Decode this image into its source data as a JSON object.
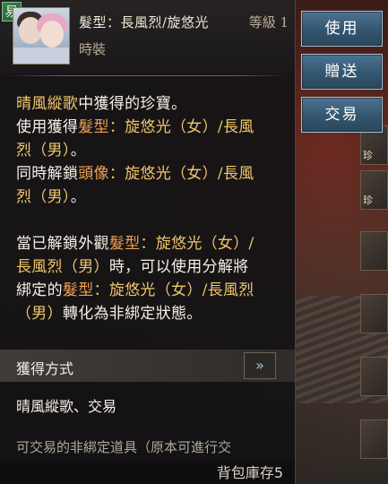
{
  "item": {
    "trade_badge": "易",
    "name": "髮型：長風烈/旋悠光",
    "level": "等級 1",
    "type": "時裝"
  },
  "description": {
    "line1": [
      {
        "text": "晴風縱歌",
        "color": "gold"
      },
      {
        "text": "中獲得的珍寶。",
        "color": "white"
      }
    ],
    "line2": [
      {
        "text": "使用獲得",
        "color": "white"
      },
      {
        "text": "髮型",
        "color": "orange"
      },
      {
        "text": "：旋悠光（女）/長風",
        "color": "gold"
      }
    ],
    "line3": [
      {
        "text": "烈（男）",
        "color": "gold"
      },
      {
        "text": "。",
        "color": "white"
      }
    ],
    "line4": [
      {
        "text": "同時解鎖",
        "color": "white"
      },
      {
        "text": "頭像",
        "color": "orange"
      },
      {
        "text": "：旋悠光（女）/長風",
        "color": "gold"
      }
    ],
    "line5": [
      {
        "text": "烈（男）",
        "color": "gold"
      },
      {
        "text": "。",
        "color": "white"
      }
    ],
    "line6": [
      {
        "text": "當已解鎖外觀",
        "color": "white"
      },
      {
        "text": "髮型",
        "color": "orange"
      },
      {
        "text": "：旋悠光（女）/",
        "color": "gold"
      }
    ],
    "line7": [
      {
        "text": "長風烈（男）",
        "color": "gold"
      },
      {
        "text": "時，可以使用分解將",
        "color": "white"
      }
    ],
    "line8": [
      {
        "text": "綁定的",
        "color": "white"
      },
      {
        "text": "髮型",
        "color": "orange"
      },
      {
        "text": "：旋悠光（女）/長風烈",
        "color": "gold"
      }
    ],
    "line9": [
      {
        "text": "（男）",
        "color": "gold"
      },
      {
        "text": "轉化為非綁定狀態。",
        "color": "white"
      }
    ]
  },
  "obtain": {
    "title": "獲得方式",
    "arrow_icon": "double-chevron-right-icon",
    "sources": "晴風縱歌、交易",
    "cutoff_note": "可交易的非綁定道具（原本可進行交"
  },
  "inventory": {
    "label": "背包庫存5"
  },
  "actions": {
    "use_label": "使用",
    "gift_label": "贈送",
    "trade_label": "交易"
  },
  "side_slots": {
    "slot1_tag": "珍",
    "slot2_tag": "珍"
  },
  "colors": {
    "gold": "#f0c66a",
    "orange": "#f0a050",
    "white": "#f4f0e6",
    "button_border": "#a8c4d8",
    "button_fill": "#34566f",
    "trade_badge": "#3f7f4f"
  }
}
